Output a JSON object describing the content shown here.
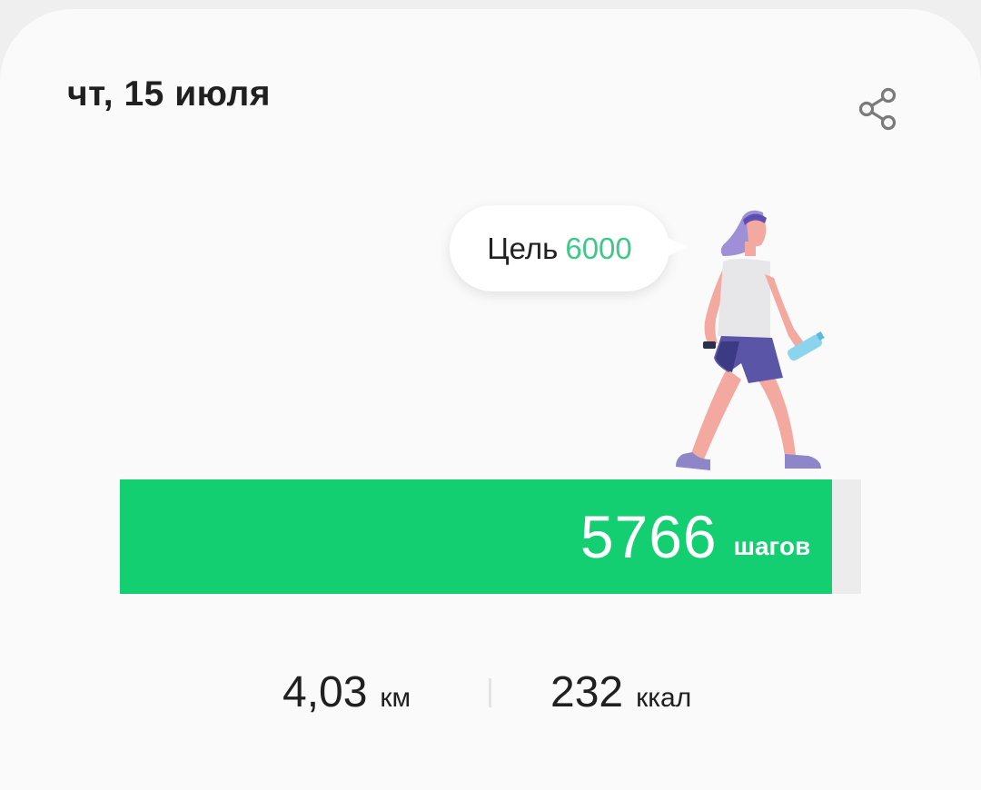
{
  "header": {
    "date": "чт, 15 июля",
    "share_icon": "share-icon"
  },
  "goal": {
    "label": "Цель",
    "value": "6000"
  },
  "steps": {
    "value": "5766",
    "unit": "шагов",
    "progress_fraction": 0.961
  },
  "stats": {
    "distance_value": "4,03",
    "distance_unit": "км",
    "calories_value": "232",
    "calories_unit": "ккал"
  },
  "colors": {
    "accent_green": "#14cf71",
    "goal_green": "#3ec98a",
    "track": "#ececec",
    "text": "#202020"
  }
}
